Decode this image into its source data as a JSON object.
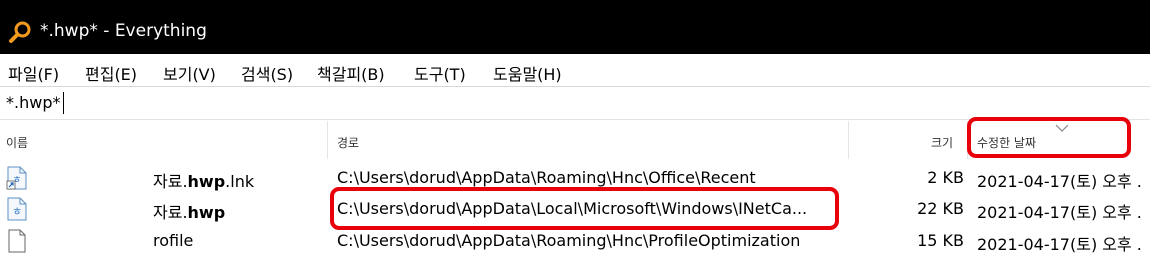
{
  "window": {
    "title": "*.hwp* - Everything",
    "icon": "search-magnifier-icon"
  },
  "menu": [
    "파일(F)",
    "편집(E)",
    "보기(V)",
    "검색(S)",
    "책갈피(B)",
    "도구(T)",
    "도움말(H)"
  ],
  "search": {
    "value": "*.hwp*"
  },
  "columns": {
    "name": "이름",
    "path": "경로",
    "size": "크기",
    "modified": "수정한 날짜"
  },
  "rows": [
    {
      "name_prefix": "자료.",
      "name_bold": "hwp",
      "name_suffix": ".lnk",
      "path": "C:\\Users\\dorud\\AppData\\Roaming\\Hnc\\Office\\Recent",
      "size": "2 KB",
      "modified": "2021-04-17(토) 오후 .",
      "icon": "shortcut-hwp-icon"
    },
    {
      "name_prefix": "자료.",
      "name_bold": "hwp",
      "name_suffix": "",
      "path": "C:\\Users\\dorud\\AppData\\Local\\Microsoft\\Windows\\INetCa...",
      "size": "22 KB",
      "modified": "2021-04-17(토) 오후 .",
      "icon": "hwp-document-icon"
    },
    {
      "name_prefix": "rofile",
      "name_bold": "",
      "name_suffix": "",
      "path": "C:\\Users\\dorud\\AppData\\Roaming\\Hnc\\ProfileOptimization",
      "size": "15 KB",
      "modified": "2021-04-17(토) 오후 .",
      "icon": "blank-file-icon"
    }
  ],
  "colors": {
    "titlebar": "#000000",
    "highlight": "#e8000b",
    "icon_accent": "#2f79c7"
  }
}
